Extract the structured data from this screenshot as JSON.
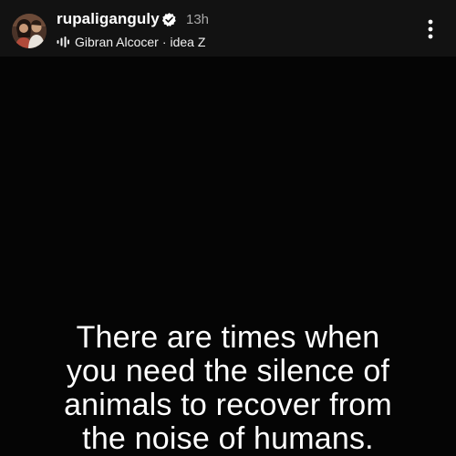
{
  "header": {
    "username": "rupaliganguly",
    "timestamp": "13h",
    "music": {
      "artist": "Gibran Alcocer",
      "separator": "·",
      "track": "idea Z"
    },
    "icons": {
      "verified": "verified-badge-icon",
      "audio": "audio-eq-icon",
      "more": "more-options-icon"
    }
  },
  "story": {
    "quote_lines": [
      "There are times when",
      "you need the silence of",
      "animals to recover from",
      "the noise of humans."
    ]
  },
  "colors": {
    "background": "#050505",
    "header_background": "#121212",
    "text": "#ffffff",
    "muted_text": "#a8a8a8"
  }
}
